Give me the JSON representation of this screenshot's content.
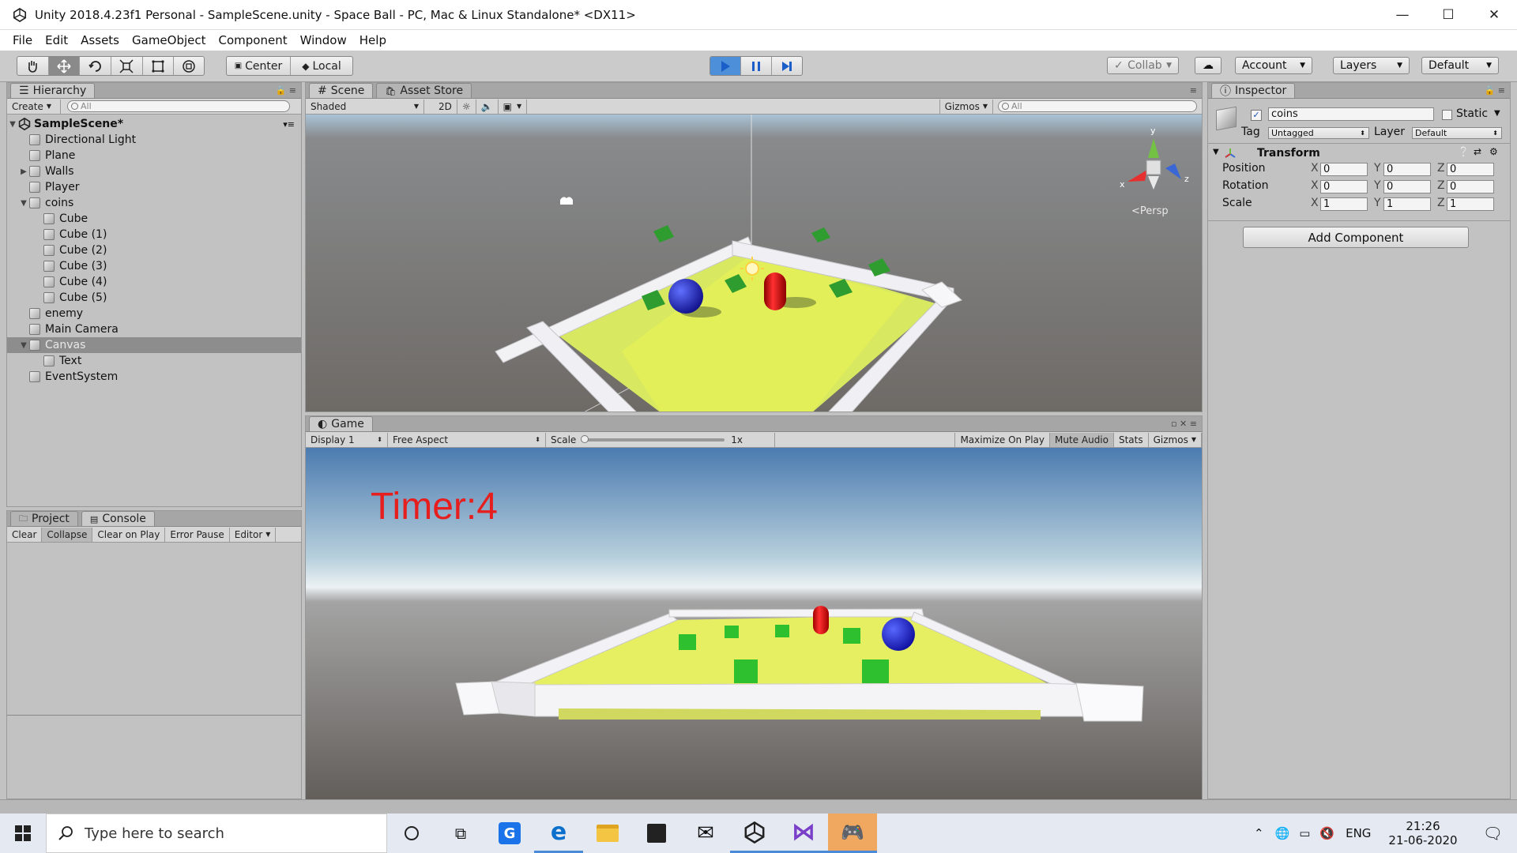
{
  "window": {
    "title": "Unity 2018.4.23f1 Personal - SampleScene.unity - Space Ball - PC, Mac & Linux Standalone* <DX11>",
    "minimize": "—",
    "maximize": "☐",
    "close": "✕"
  },
  "menu": [
    "File",
    "Edit",
    "Assets",
    "GameObject",
    "Component",
    "Window",
    "Help"
  ],
  "toolbar": {
    "center": "Center",
    "local": "Local",
    "collab": "Collab",
    "account": "Account",
    "layers": "Layers",
    "layout": "Default"
  },
  "hierarchy": {
    "tab": "Hierarchy",
    "create": "Create",
    "search_placeholder": "All",
    "scene": "SampleScene*",
    "items": [
      {
        "name": "Directional Light",
        "indent": 1,
        "fold": ""
      },
      {
        "name": "Plane",
        "indent": 1,
        "fold": ""
      },
      {
        "name": "Walls",
        "indent": 1,
        "fold": "▶"
      },
      {
        "name": "Player",
        "indent": 1,
        "fold": ""
      },
      {
        "name": "coins",
        "indent": 1,
        "fold": "▼"
      },
      {
        "name": "Cube",
        "indent": 2,
        "fold": ""
      },
      {
        "name": "Cube (1)",
        "indent": 2,
        "fold": ""
      },
      {
        "name": "Cube (2)",
        "indent": 2,
        "fold": ""
      },
      {
        "name": "Cube (3)",
        "indent": 2,
        "fold": ""
      },
      {
        "name": "Cube (4)",
        "indent": 2,
        "fold": ""
      },
      {
        "name": "Cube (5)",
        "indent": 2,
        "fold": ""
      },
      {
        "name": "enemy",
        "indent": 1,
        "fold": ""
      },
      {
        "name": "Main Camera",
        "indent": 1,
        "fold": ""
      },
      {
        "name": "Canvas",
        "indent": 1,
        "fold": "▼",
        "selected": true
      },
      {
        "name": "Text",
        "indent": 2,
        "fold": ""
      },
      {
        "name": "EventSystem",
        "indent": 1,
        "fold": ""
      }
    ]
  },
  "console": {
    "tabs": [
      "Project",
      "Console"
    ],
    "buttons": [
      "Clear",
      "Collapse",
      "Clear on Play",
      "Error Pause",
      "Editor"
    ]
  },
  "scene": {
    "tabs": [
      "Scene",
      "Asset Store"
    ],
    "shading": "Shaded",
    "mode2d": "2D",
    "gizmos": "Gizmos",
    "search_placeholder": "All",
    "persp": "<Persp",
    "axis_x": "x",
    "axis_y": "y",
    "axis_z": "z"
  },
  "game": {
    "tab": "Game",
    "display": "Display 1",
    "aspect": "Free Aspect",
    "scale_label": "Scale",
    "scale_value": "1x",
    "buttons": [
      "Maximize On Play",
      "Mute Audio",
      "Stats",
      "Gizmos"
    ],
    "timer": "Timer:4"
  },
  "inspector": {
    "tab": "Inspector",
    "object_name": "coins",
    "static": "Static",
    "tag_label": "Tag",
    "tag": "Untagged",
    "layer_label": "Layer",
    "layer": "Default",
    "component": "Transform",
    "rows": [
      {
        "label": "Position",
        "x": "0",
        "y": "0",
        "z": "0"
      },
      {
        "label": "Rotation",
        "x": "0",
        "y": "0",
        "z": "0"
      },
      {
        "label": "Scale",
        "x": "1",
        "y": "1",
        "z": "1"
      }
    ],
    "add_component": "Add Component"
  },
  "taskbar": {
    "search_placeholder": "Type here to search",
    "lang": "ENG",
    "time": "21:26",
    "date": "21-06-2020"
  }
}
